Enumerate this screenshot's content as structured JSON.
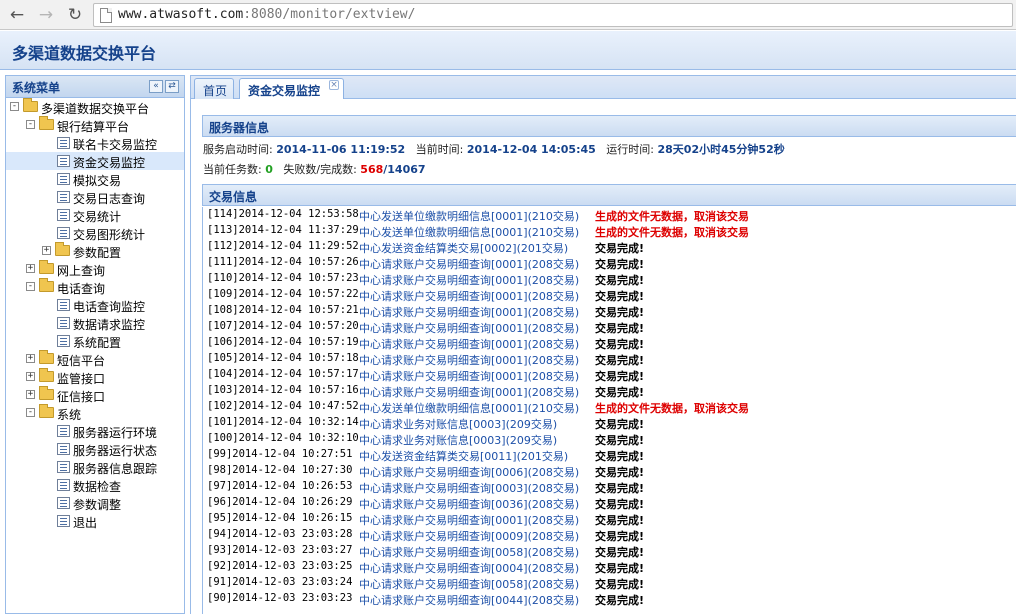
{
  "browser": {
    "url_host": "www.atwasoft.com",
    "url_rest": ":8080/monitor/extview/"
  },
  "app": {
    "title": "多渠道数据交换平台"
  },
  "sidebar": {
    "title": "系统菜单",
    "tree": [
      {
        "label": "多渠道数据交换平台",
        "level": 0,
        "type": "folder",
        "toggle": "−"
      },
      {
        "label": "银行结算平台",
        "level": 1,
        "type": "folder",
        "toggle": "−"
      },
      {
        "label": "联名卡交易监控",
        "level": 2,
        "type": "leaf"
      },
      {
        "label": "资金交易监控",
        "level": 2,
        "type": "leaf",
        "selected": true
      },
      {
        "label": "模拟交易",
        "level": 2,
        "type": "leaf"
      },
      {
        "label": "交易日志查询",
        "level": 2,
        "type": "leaf"
      },
      {
        "label": "交易统计",
        "level": 2,
        "type": "leaf"
      },
      {
        "label": "交易图形统计",
        "level": 2,
        "type": "leaf"
      },
      {
        "label": "参数配置",
        "level": 2,
        "type": "folder",
        "toggle": "+"
      },
      {
        "label": "网上查询",
        "level": 1,
        "type": "folder",
        "toggle": "+"
      },
      {
        "label": "电话查询",
        "level": 1,
        "type": "folder",
        "toggle": "−"
      },
      {
        "label": "电话查询监控",
        "level": 2,
        "type": "leaf"
      },
      {
        "label": "数据请求监控",
        "level": 2,
        "type": "leaf"
      },
      {
        "label": "系统配置",
        "level": 2,
        "type": "leaf"
      },
      {
        "label": "短信平台",
        "level": 1,
        "type": "folder",
        "toggle": "+"
      },
      {
        "label": "监管接口",
        "level": 1,
        "type": "folder",
        "toggle": "+"
      },
      {
        "label": "征信接口",
        "level": 1,
        "type": "folder",
        "toggle": "+"
      },
      {
        "label": "系统",
        "level": 1,
        "type": "folder",
        "toggle": "−"
      },
      {
        "label": "服务器运行环境",
        "level": 2,
        "type": "leaf"
      },
      {
        "label": "服务器运行状态",
        "level": 2,
        "type": "leaf"
      },
      {
        "label": "服务器信息跟踪",
        "level": 2,
        "type": "leaf"
      },
      {
        "label": "数据检查",
        "level": 2,
        "type": "leaf"
      },
      {
        "label": "参数调整",
        "level": 2,
        "type": "leaf"
      },
      {
        "label": "退出",
        "level": 2,
        "type": "leaf"
      }
    ]
  },
  "tabs": [
    {
      "label": "首页"
    },
    {
      "label": "资金交易监控",
      "active": true
    }
  ],
  "server": {
    "heading": "服务器信息",
    "start_label": "服务启动时间:",
    "start_value": "2014-11-06 11:19:52",
    "now_label": "当前时间:",
    "now_value": "2014-12-04 14:05:45",
    "uptime_label": "运行时间:",
    "uptime_value": "28天02小时45分钟52秒",
    "tasks_label": "当前任务数:",
    "tasks_value": "0",
    "fail_label": "失败数/完成数:",
    "fail_value": "568",
    "done_value": "/14067"
  },
  "transactions": {
    "heading": "交易信息",
    "rows": [
      {
        "id": "[114]2014-12-04 12:53:58",
        "desc": "中心发送单位缴款明细信息[0001](210交易)",
        "result": "生成的文件无数据，取消该交易",
        "status": "error"
      },
      {
        "id": "[113]2014-12-04 11:37:29",
        "desc": "中心发送单位缴款明细信息[0001](210交易)",
        "result": "生成的文件无数据，取消该交易",
        "status": "error"
      },
      {
        "id": "[112]2014-12-04 11:29:52",
        "desc": "中心发送资金结算类交易[0002](201交易)",
        "result": "交易完成!",
        "status": "ok"
      },
      {
        "id": "[111]2014-12-04 10:57:26",
        "desc": "中心请求账户交易明细查询[0001](208交易)",
        "result": "交易完成!",
        "status": "ok"
      },
      {
        "id": "[110]2014-12-04 10:57:23",
        "desc": "中心请求账户交易明细查询[0001](208交易)",
        "result": "交易完成!",
        "status": "ok"
      },
      {
        "id": "[109]2014-12-04 10:57:22",
        "desc": "中心请求账户交易明细查询[0001](208交易)",
        "result": "交易完成!",
        "status": "ok"
      },
      {
        "id": "[108]2014-12-04 10:57:21",
        "desc": "中心请求账户交易明细查询[0001](208交易)",
        "result": "交易完成!",
        "status": "ok"
      },
      {
        "id": "[107]2014-12-04 10:57:20",
        "desc": "中心请求账户交易明细查询[0001](208交易)",
        "result": "交易完成!",
        "status": "ok"
      },
      {
        "id": "[106]2014-12-04 10:57:19",
        "desc": "中心请求账户交易明细查询[0001](208交易)",
        "result": "交易完成!",
        "status": "ok"
      },
      {
        "id": "[105]2014-12-04 10:57:18",
        "desc": "中心请求账户交易明细查询[0001](208交易)",
        "result": "交易完成!",
        "status": "ok"
      },
      {
        "id": "[104]2014-12-04 10:57:17",
        "desc": "中心请求账户交易明细查询[0001](208交易)",
        "result": "交易完成!",
        "status": "ok"
      },
      {
        "id": "[103]2014-12-04 10:57:16",
        "desc": "中心请求账户交易明细查询[0001](208交易)",
        "result": "交易完成!",
        "status": "ok"
      },
      {
        "id": "[102]2014-12-04 10:47:52",
        "desc": "中心发送单位缴款明细信息[0001](210交易)",
        "result": "生成的文件无数据，取消该交易",
        "status": "error"
      },
      {
        "id": "[101]2014-12-04 10:32:14",
        "desc": "中心请求业务对账信息[0003](209交易)",
        "result": "交易完成!",
        "status": "ok"
      },
      {
        "id": "[100]2014-12-04 10:32:10",
        "desc": "中心请求业务对账信息[0003](209交易)",
        "result": "交易完成!",
        "status": "ok"
      },
      {
        "id": "[99]2014-12-04 10:27:51",
        "desc": "中心发送资金结算类交易[0011](201交易)",
        "result": "交易完成!",
        "status": "ok"
      },
      {
        "id": "[98]2014-12-04 10:27:30",
        "desc": "中心请求账户交易明细查询[0006](208交易)",
        "result": "交易完成!",
        "status": "ok"
      },
      {
        "id": "[97]2014-12-04 10:26:53",
        "desc": "中心请求账户交易明细查询[0003](208交易)",
        "result": "交易完成!",
        "status": "ok"
      },
      {
        "id": "[96]2014-12-04 10:26:29",
        "desc": "中心请求账户交易明细查询[0036](208交易)",
        "result": "交易完成!",
        "status": "ok"
      },
      {
        "id": "[95]2014-12-04 10:26:15",
        "desc": "中心请求账户交易明细查询[0001](208交易)",
        "result": "交易完成!",
        "status": "ok"
      },
      {
        "id": "[94]2014-12-03 23:03:28",
        "desc": "中心请求账户交易明细查询[0009](208交易)",
        "result": "交易完成!",
        "status": "ok"
      },
      {
        "id": "[93]2014-12-03 23:03:27",
        "desc": "中心请求账户交易明细查询[0058](208交易)",
        "result": "交易完成!",
        "status": "ok"
      },
      {
        "id": "[92]2014-12-03 23:03:25",
        "desc": "中心请求账户交易明细查询[0004](208交易)",
        "result": "交易完成!",
        "status": "ok"
      },
      {
        "id": "[91]2014-12-03 23:03:24",
        "desc": "中心请求账户交易明细查询[0058](208交易)",
        "result": "交易完成!",
        "status": "ok"
      },
      {
        "id": "[90]2014-12-03 23:03:23",
        "desc": "中心请求账户交易明细查询[0044](208交易)",
        "result": "交易完成!",
        "status": "ok"
      }
    ]
  }
}
